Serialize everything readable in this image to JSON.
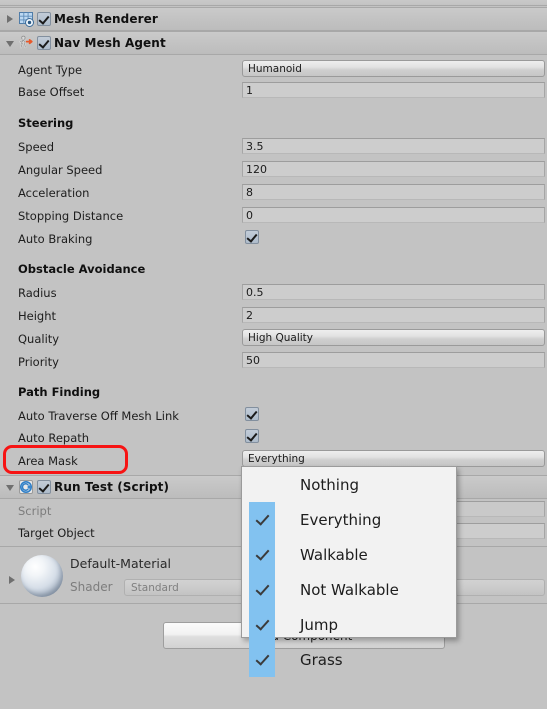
{
  "window": {
    "background_color": "#c3c3c3",
    "accent_highlight": "#82c2f0",
    "annotation_color": "#f71414"
  },
  "components": [
    {
      "name": "Mesh Renderer",
      "icon": "mesh-renderer-icon",
      "expanded": false,
      "enabled": true
    },
    {
      "name": "Nav Mesh Agent",
      "icon": "nav-mesh-agent-icon",
      "expanded": true,
      "enabled": true
    },
    {
      "name": "Run Test (Script)",
      "icon": "csharp-script-icon",
      "expanded": true,
      "enabled": true
    }
  ],
  "nav_mesh_agent": {
    "agent_type": {
      "label": "Agent Type",
      "value": "Humanoid",
      "type": "popup"
    },
    "base_offset": {
      "label": "Base Offset",
      "value": "1",
      "type": "text"
    },
    "sections": [
      {
        "title": "Steering",
        "fields": [
          {
            "label": "Speed",
            "value": "3.5",
            "type": "text"
          },
          {
            "label": "Angular Speed",
            "value": "120",
            "type": "text"
          },
          {
            "label": "Acceleration",
            "value": "8",
            "type": "text"
          },
          {
            "label": "Stopping Distance",
            "value": "0",
            "type": "text"
          },
          {
            "label": "Auto Braking",
            "value": true,
            "type": "toggle"
          }
        ]
      },
      {
        "title": "Obstacle Avoidance",
        "fields": [
          {
            "label": "Radius",
            "value": "0.5",
            "type": "text"
          },
          {
            "label": "Height",
            "value": "2",
            "type": "text"
          },
          {
            "label": "Quality",
            "value": "High Quality",
            "type": "popup"
          },
          {
            "label": "Priority",
            "value": "50",
            "type": "text"
          }
        ]
      },
      {
        "title": "Path Finding",
        "fields": [
          {
            "label": "Auto Traverse Off Mesh Link",
            "value": true,
            "type": "toggle"
          },
          {
            "label": "Auto Repath",
            "value": true,
            "type": "toggle"
          },
          {
            "label": "Area Mask",
            "value": "Everything",
            "type": "mask-popup"
          }
        ]
      }
    ]
  },
  "run_test_script": {
    "script": {
      "label": "Script",
      "value": ""
    },
    "target_object": {
      "label": "Target Object",
      "value": ""
    }
  },
  "material": {
    "name": "Default-Material",
    "shader_label": "Shader",
    "shader_value": "Standard",
    "preview_icon": "material-sphere-preview"
  },
  "add_component_button": {
    "label": "Add Component"
  },
  "area_mask_dropdown": {
    "open": true,
    "items": [
      {
        "label": "Nothing",
        "checked": false
      },
      {
        "label": "Everything",
        "checked": true
      },
      {
        "label": "Walkable",
        "checked": true
      },
      {
        "label": "Not Walkable",
        "checked": true
      },
      {
        "label": "Jump",
        "checked": true
      },
      {
        "label": "Grass",
        "checked": true
      }
    ]
  }
}
